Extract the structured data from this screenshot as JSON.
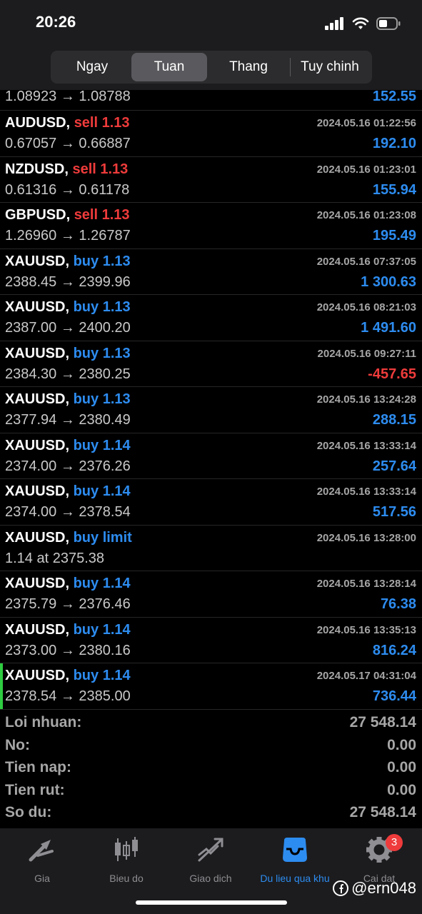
{
  "status": {
    "time": "20:26"
  },
  "periods": [
    {
      "label": "Ngay"
    },
    {
      "label": "Tuan",
      "active": true
    },
    {
      "label": "Thang"
    },
    {
      "label": "Tuy chinh"
    }
  ],
  "first_row": {
    "prices": "1.08923 → 1.08788",
    "profit": "152.55"
  },
  "rows": [
    {
      "symbol": "AUDUSD,",
      "side": "sell",
      "volume": "1.13",
      "time": "2024.05.16 01:22:56",
      "prices": "0.67057 → 0.66887",
      "profit": "192.10"
    },
    {
      "symbol": "NZDUSD,",
      "side": "sell",
      "volume": "1.13",
      "time": "2024.05.16 01:23:01",
      "prices": "0.61316 → 0.61178",
      "profit": "155.94"
    },
    {
      "symbol": "GBPUSD,",
      "side": "sell",
      "volume": "1.13",
      "time": "2024.05.16 01:23:08",
      "prices": "1.26960 → 1.26787",
      "profit": "195.49"
    },
    {
      "symbol": "XAUUSD,",
      "side": "buy",
      "volume": "1.13",
      "time": "2024.05.16 07:37:05",
      "prices": "2388.45 → 2399.96",
      "profit": "1 300.63"
    },
    {
      "symbol": "XAUUSD,",
      "side": "buy",
      "volume": "1.13",
      "time": "2024.05.16 08:21:03",
      "prices": "2387.00 → 2400.20",
      "profit": "1 491.60"
    },
    {
      "symbol": "XAUUSD,",
      "side": "buy",
      "volume": "1.13",
      "time": "2024.05.16 09:27:11",
      "prices": "2384.30 → 2380.25",
      "profit": "-457.65"
    },
    {
      "symbol": "XAUUSD,",
      "side": "buy",
      "volume": "1.13",
      "time": "2024.05.16 13:24:28",
      "prices": "2377.94 → 2380.49",
      "profit": "288.15"
    },
    {
      "symbol": "XAUUSD,",
      "side": "buy",
      "volume": "1.14",
      "time": "2024.05.16 13:33:14",
      "prices": "2374.00 → 2376.26",
      "profit": "257.64"
    },
    {
      "symbol": "XAUUSD,",
      "side": "buy",
      "volume": "1.14",
      "time": "2024.05.16 13:33:14",
      "prices": "2374.00 → 2378.54",
      "profit": "517.56"
    },
    {
      "symbol": "XAUUSD,",
      "side": "buy limit",
      "volume": "",
      "time": "2024.05.16 13:28:00",
      "prices": "1.14 at 2375.38",
      "profit": ""
    },
    {
      "symbol": "XAUUSD,",
      "side": "buy",
      "volume": "1.14",
      "time": "2024.05.16 13:28:14",
      "prices": "2375.79 → 2376.46",
      "profit": "76.38"
    },
    {
      "symbol": "XAUUSD,",
      "side": "buy",
      "volume": "1.14",
      "time": "2024.05.16 13:35:13",
      "prices": "2373.00 → 2380.16",
      "profit": "816.24"
    },
    {
      "symbol": "XAUUSD,",
      "side": "buy",
      "volume": "1.14",
      "time": "2024.05.17 04:31:04",
      "prices": "2378.54 → 2385.00",
      "profit": "736.44",
      "marked": true
    }
  ],
  "summary": [
    {
      "label": "Loi nhuan:",
      "value": "27 548.14"
    },
    {
      "label": "No:",
      "value": "0.00"
    },
    {
      "label": "Tien nap:",
      "value": "0.00"
    },
    {
      "label": "Tien rut:",
      "value": "0.00"
    },
    {
      "label": "So du:",
      "value": "27 548.14"
    }
  ],
  "tabs": [
    {
      "label": "Gia",
      "icon": "quotes-icon"
    },
    {
      "label": "Bieu do",
      "icon": "chart-icon"
    },
    {
      "label": "Giao dich",
      "icon": "trade-icon"
    },
    {
      "label": "Du lieu qua khu",
      "icon": "history-icon",
      "active": true
    },
    {
      "label": "Cai dat",
      "icon": "gear-icon",
      "badge": "3"
    }
  ],
  "watermark": "@ern048",
  "colors": {
    "buy": "#2d8cf0",
    "sell": "#ef3b3b",
    "accent": "#2d8cf0",
    "marker": "#2ecc40"
  }
}
